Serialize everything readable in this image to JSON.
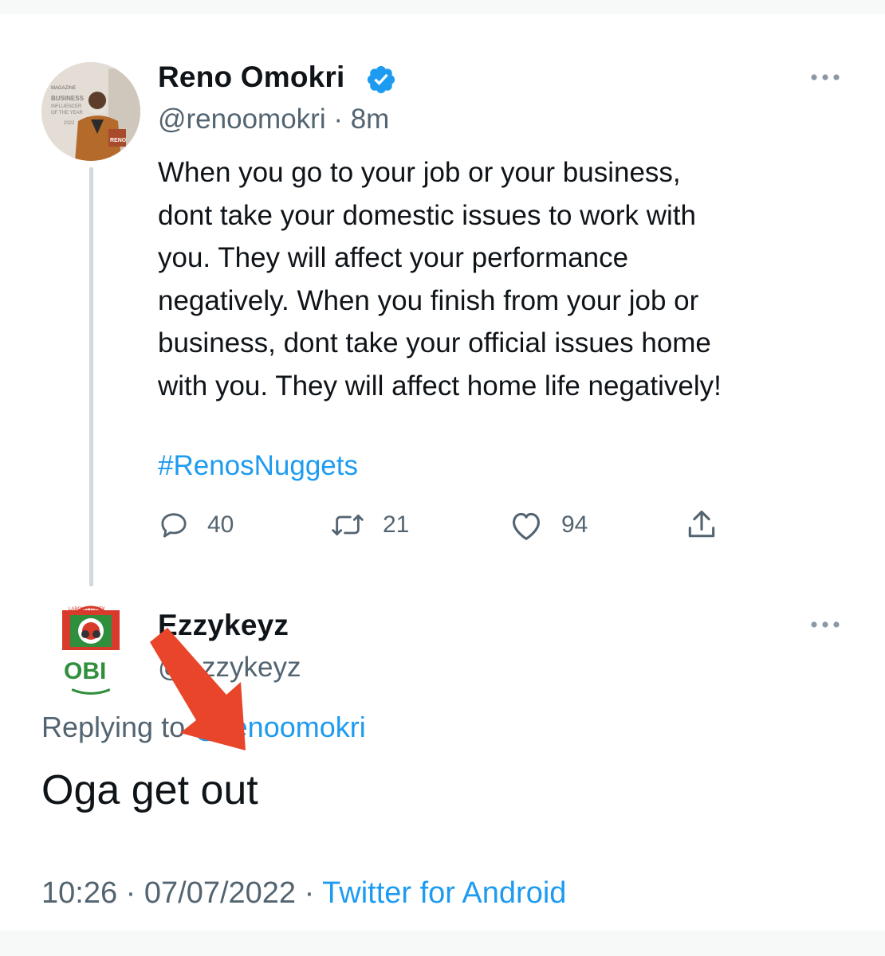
{
  "tweet": {
    "author_name": "Reno Omokri",
    "verified": true,
    "handle": "@renoomokri",
    "time_ago": "8m",
    "text": "When you go to your job or your business,\ndont take your domestic issues to work with\nyou. They will affect your performance\nnegatively. When you finish from your job or\nbusiness, dont take your official issues home\nwith you. They will affect home life negatively!",
    "hashtag": "#RenosNuggets",
    "actions": {
      "replies": "40",
      "retweets": "21",
      "likes": "94"
    },
    "avatar_text": {
      "line1": "BUSINESS",
      "line2": "INFLUENCER",
      "line3": "OF THE YEAR",
      "year": "2022",
      "badge": "RENO"
    }
  },
  "reply": {
    "author_name": "Ezzykeyz",
    "handle": "@ezzykeyz",
    "replying_label": "Replying to",
    "replying_to": "@renoomokri",
    "text": "Oga get out",
    "avatar_text": "OBI",
    "avatar_ring_text": "LABOUR PARTY"
  },
  "footer": {
    "time": "10:26",
    "date": "07/07/2022",
    "source": "Twitter for Android"
  },
  "colors": {
    "accent": "#1d9bf0",
    "secondary_text": "#536471",
    "annotation_arrow": "#e8452a"
  },
  "icons": [
    "verified-badge-icon",
    "more-icon",
    "reply-icon",
    "retweet-icon",
    "like-icon",
    "share-icon"
  ]
}
